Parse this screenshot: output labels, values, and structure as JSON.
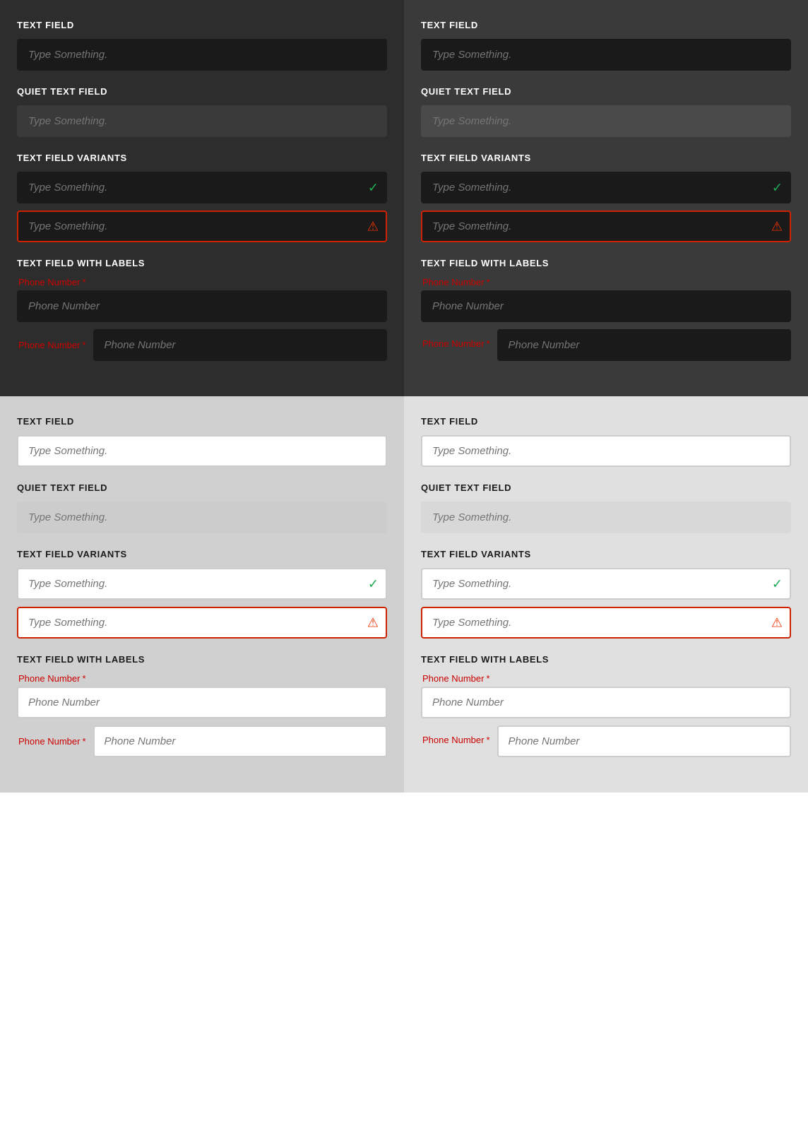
{
  "panels": {
    "dark1": {
      "theme": "dark",
      "bg": "#2d2d2d",
      "sections": {
        "text_field": "TEXT FIELD",
        "quiet_text_field": "QUIET TEXT FIELD",
        "text_field_variants": "TEXT FIELD VARIANTS",
        "text_field_with_labels": "TEXT FIELD WITH LABELS"
      },
      "placeholder": "Type Something.",
      "phone_placeholder": "Phone Number",
      "phone_label": "Phone Number",
      "required_star": "*"
    },
    "dark2": {
      "theme": "dark-alt",
      "bg": "#3a3a3a",
      "sections": {
        "text_field": "TEXT FIELD",
        "quiet_text_field": "QUIET TEXT FIELD",
        "text_field_variants": "TEXT FIELD VARIANTS",
        "text_field_with_labels": "TEXT FIELD WITH LABELS"
      },
      "placeholder": "Type Something.",
      "phone_placeholder": "Phone Number",
      "phone_label": "Phone Number",
      "required_star": "*"
    },
    "light1": {
      "theme": "light",
      "bg": "#d0d0d0",
      "sections": {
        "text_field": "TEXT FIELD",
        "quiet_text_field": "QUIET TEXT FIELD",
        "text_field_variants": "TEXT FIELD VARIANTS",
        "text_field_with_labels": "TEXT FIELD WITH LABELS"
      },
      "placeholder": "Type Something.",
      "phone_placeholder": "Phone Number",
      "phone_label": "Phone Number",
      "required_star": "*"
    },
    "light2": {
      "theme": "light-alt",
      "bg": "#e0e0e0",
      "sections": {
        "text_field": "TEXT FIELD",
        "quiet_text_field": "QUIET TEXT FIELD",
        "text_field_variants": "TEXT FIELD VARIANTS",
        "text_field_with_labels": "TEXT FIELD WITH LABELS"
      },
      "placeholder": "Type Something.",
      "phone_placeholder": "Phone Number",
      "phone_label": "Phone Number",
      "required_star": "*"
    }
  }
}
